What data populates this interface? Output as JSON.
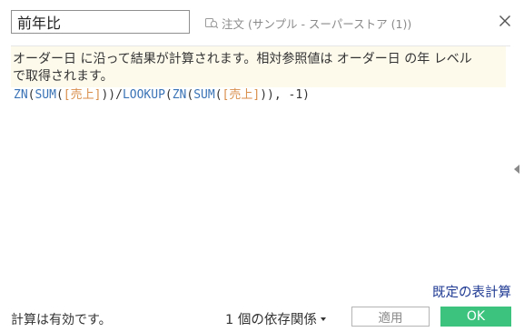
{
  "calc": {
    "name": "前年比"
  },
  "source": {
    "label": "注文 (サンプル - スーパーストア (1))",
    "icon": "database-icon"
  },
  "description": {
    "line1": "オーダー日 に沿って結果が計算されます。相対参照値は オーダー日 の年 レベル",
    "line2": "で取得されます。"
  },
  "formula": {
    "tokens": [
      {
        "t": "ZN",
        "k": "fn"
      },
      {
        "t": "(",
        "k": "op"
      },
      {
        "t": "SUM",
        "k": "fn"
      },
      {
        "t": "(",
        "k": "op"
      },
      {
        "t": "[売上]",
        "k": "field"
      },
      {
        "t": "))/",
        "k": "op"
      },
      {
        "t": "LOOKUP",
        "k": "fn"
      },
      {
        "t": "(",
        "k": "op"
      },
      {
        "t": "ZN",
        "k": "fn"
      },
      {
        "t": "(",
        "k": "op"
      },
      {
        "t": "SUM",
        "k": "fn"
      },
      {
        "t": "(",
        "k": "op"
      },
      {
        "t": "[売上]",
        "k": "field"
      },
      {
        "t": ")), -1)",
        "k": "op"
      }
    ]
  },
  "links": {
    "default_table_calc": "既定の表計算"
  },
  "footer": {
    "status": "計算は有効です。",
    "dependencies": "1 個の依存関係",
    "apply": "適用",
    "ok": "OK"
  },
  "colors": {
    "ok_button": "#3cc47f",
    "function": "#3a73b6",
    "field": "#d88e4a",
    "link": "#1f3a93",
    "description_bg": "#fdfaec"
  }
}
